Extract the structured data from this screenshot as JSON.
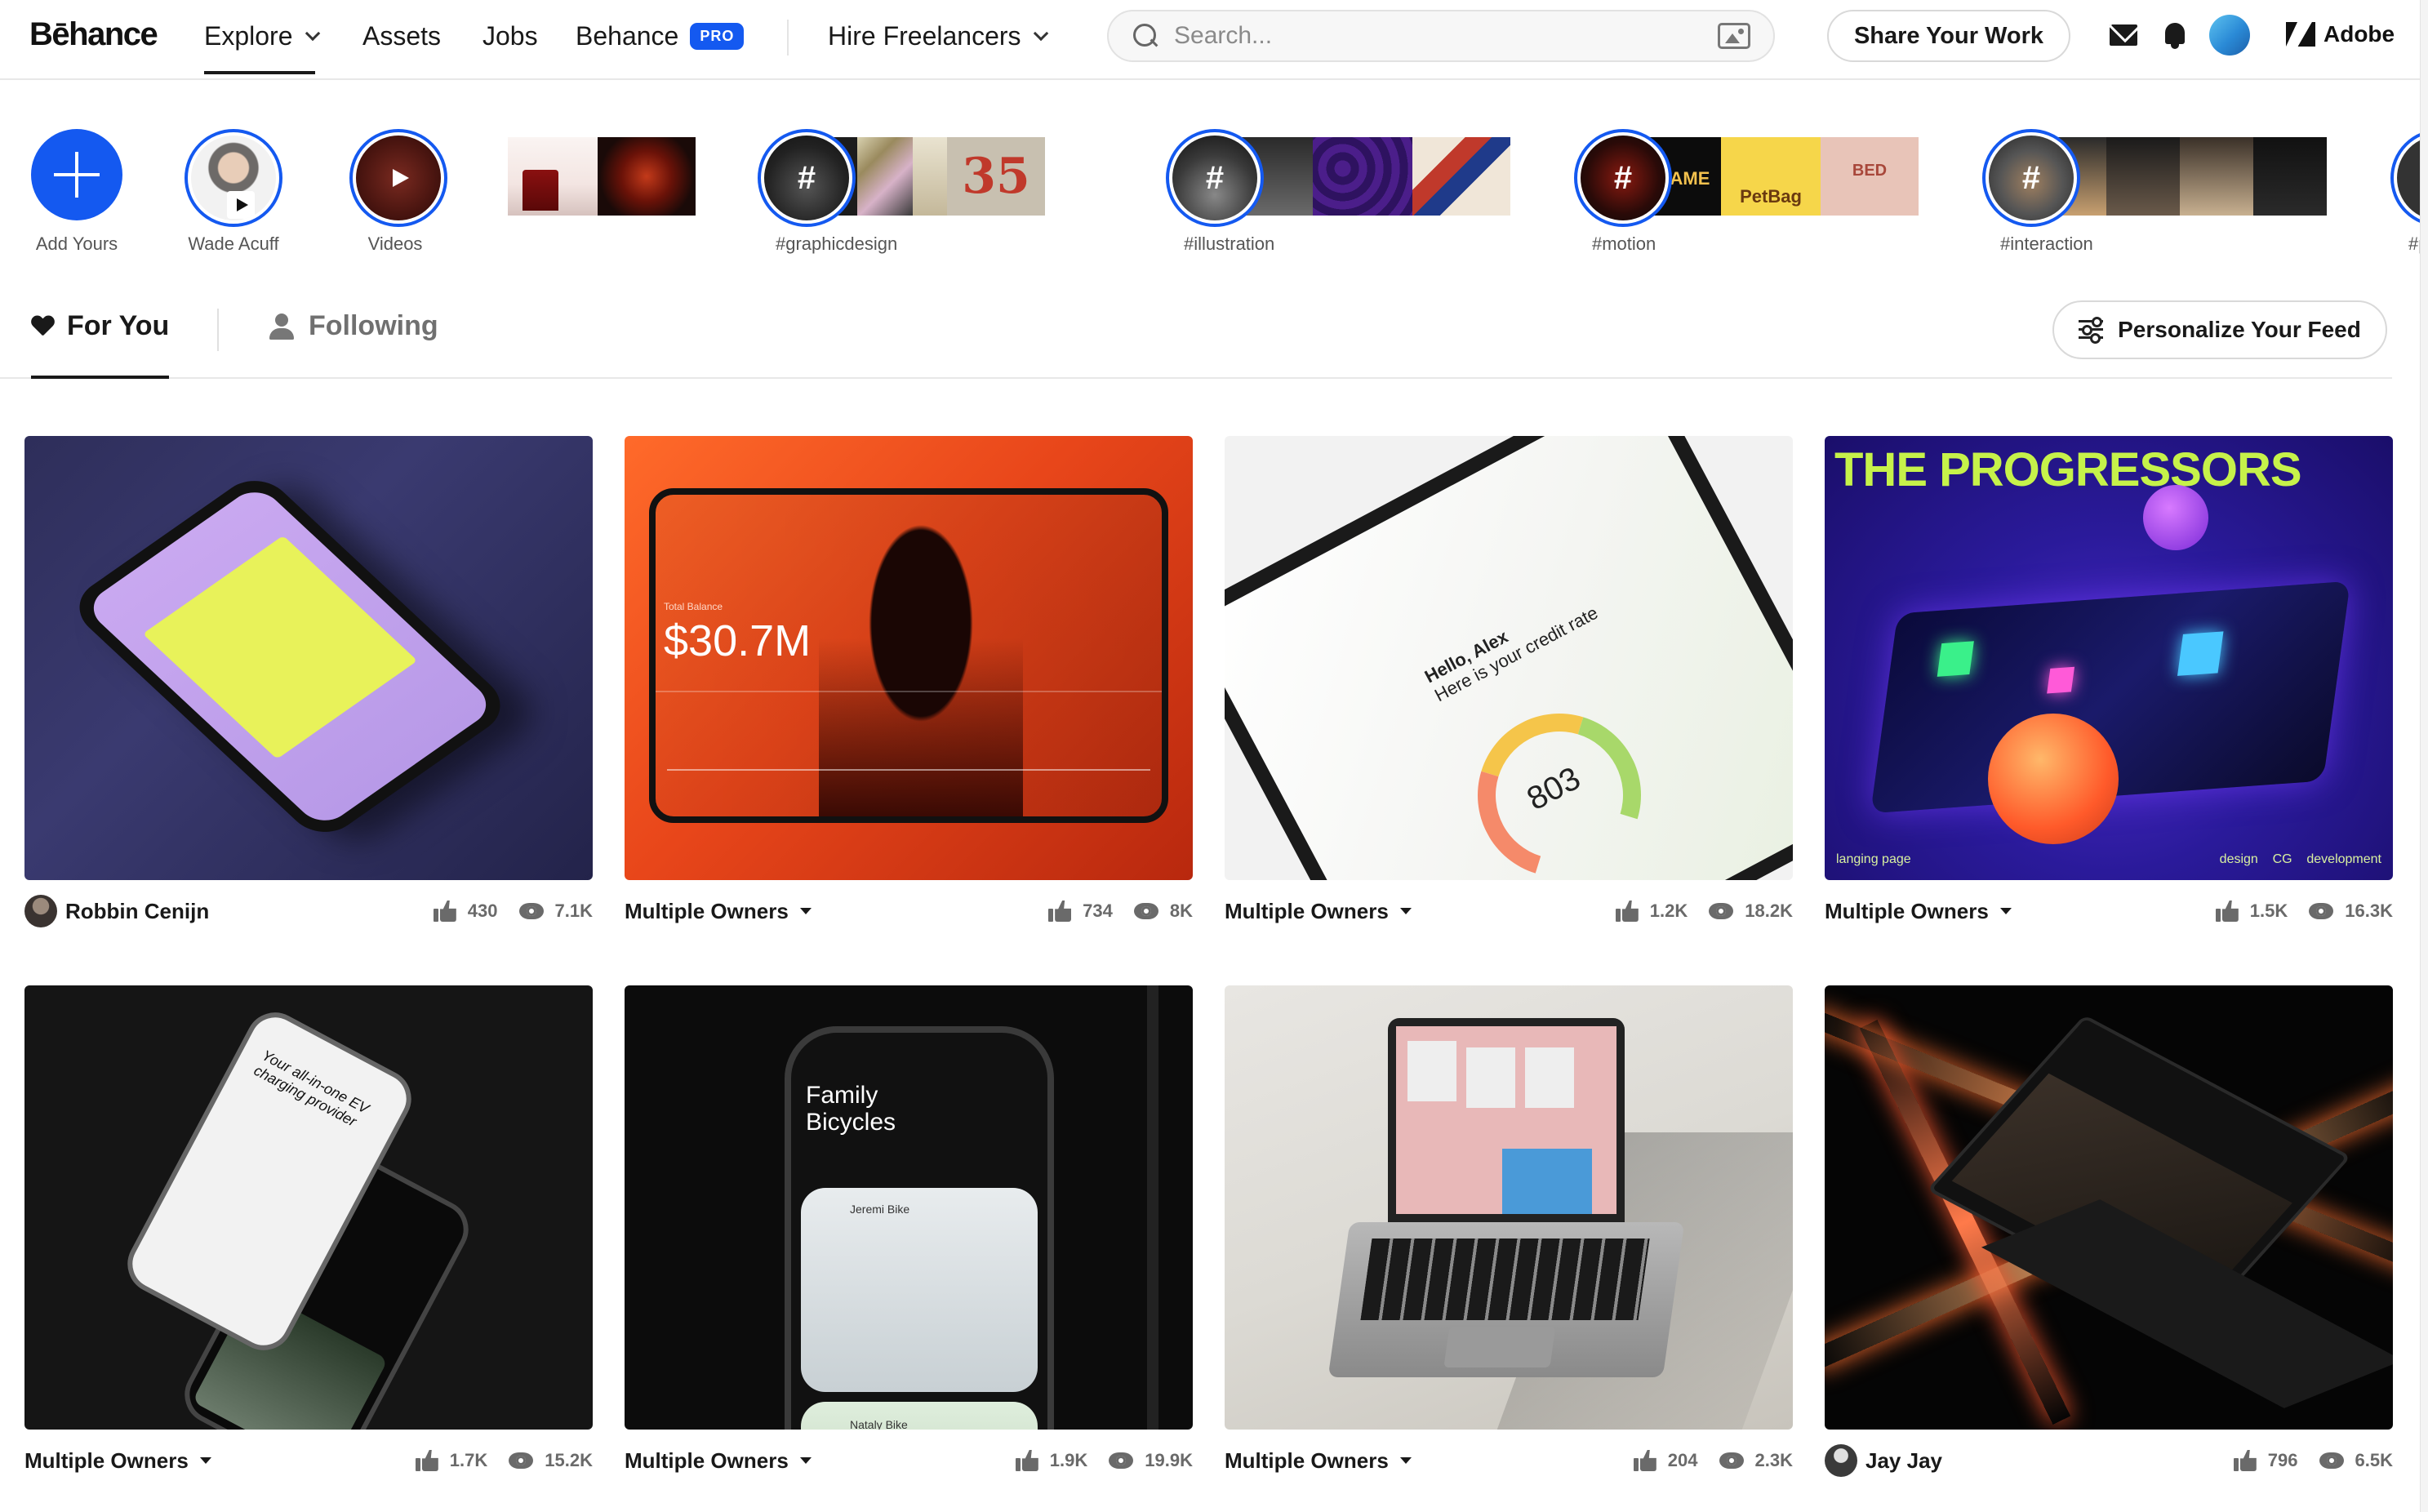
{
  "nav": {
    "logo": "Bēhance",
    "items": [
      {
        "label": "Explore",
        "has_chevron": true
      },
      {
        "label": "Assets"
      },
      {
        "label": "Jobs"
      },
      {
        "label": "Behance",
        "badge": "PRO"
      },
      {
        "label": "Hire Freelancers",
        "has_chevron": true
      }
    ],
    "search_placeholder": "Search...",
    "share_label": "Share Your Work",
    "adobe_label": "Adobe",
    "accent_color": "#1459f0"
  },
  "stories": [
    {
      "label": "Add Yours",
      "type": "add"
    },
    {
      "label": "Wade Acuff",
      "type": "person"
    },
    {
      "label": "Videos",
      "type": "video"
    },
    {
      "label": "",
      "type": "strip-only"
    },
    {
      "label": "#graphicdesign",
      "type": "hashtag"
    },
    {
      "label": "#illustration",
      "type": "hashtag"
    },
    {
      "label": "#motion",
      "type": "hashtag"
    },
    {
      "label": "#interaction",
      "type": "hashtag"
    },
    {
      "label": "#p",
      "type": "hashtag"
    }
  ],
  "feed_tabs": {
    "for_you": "For You",
    "following": "Following",
    "personalize": "Personalize Your Feed"
  },
  "projects": [
    {
      "owner": "Robbin Cenijn",
      "multiple": false,
      "likes": "430",
      "views": "7.1K"
    },
    {
      "owner": "Multiple Owners",
      "multiple": true,
      "likes": "734",
      "views": "8K",
      "overlay_text": "$30.7M",
      "overlay_sub": "Total Balance"
    },
    {
      "owner": "Multiple Owners",
      "multiple": true,
      "likes": "1.2K",
      "views": "18.2K",
      "overlay_text": "Hello, Alex",
      "overlay_sub": "Here is your credit rate",
      "score": "803"
    },
    {
      "owner": "Multiple Owners",
      "multiple": true,
      "likes": "1.5K",
      "views": "16.3K",
      "overlay_text": "THE PROGRESSORS",
      "tags_left": "langing page",
      "tags_right": "design    CG    development"
    },
    {
      "owner": "Multiple Owners",
      "multiple": true,
      "likes": "1.7K",
      "views": "15.2K",
      "overlay_text": "Your all-in-one EV charging provider"
    },
    {
      "owner": "Multiple Owners",
      "multiple": true,
      "likes": "1.9K",
      "views": "19.9K",
      "overlay_text": "Family Bicycles",
      "item1": "Jeremi Bike",
      "item2": "Nataly Bike"
    },
    {
      "owner": "Multiple Owners",
      "multiple": true,
      "likes": "204",
      "views": "2.3K"
    },
    {
      "owner": "Jay Jay",
      "multiple": false,
      "likes": "796",
      "views": "6.5K"
    }
  ]
}
